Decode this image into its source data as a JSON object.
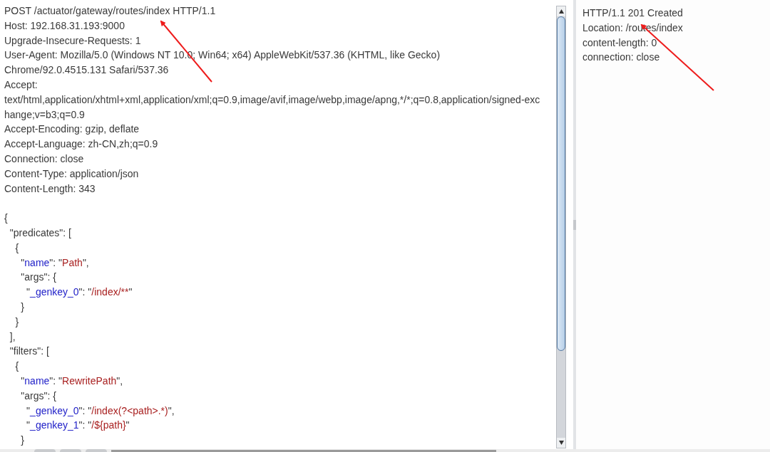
{
  "request": {
    "header_lines": [
      "POST /actuator/gateway/routes/index HTTP/1.1",
      "Host: 192.168.31.193:9000",
      "Upgrade-Insecure-Requests: 1",
      "User-Agent: Mozilla/5.0 (Windows NT 10.0; Win64; x64) AppleWebKit/537.36 (KHTML, like Gecko)",
      "Chrome/92.0.4515.131 Safari/537.36",
      "Accept:",
      "text/html,application/xhtml+xml,application/xml;q=0.9,image/avif,image/webp,image/apng,*/*;q=0.8,application/signed-exc",
      "hange;v=b3;q=0.9",
      "Accept-Encoding: gzip, deflate",
      "Accept-Language: zh-CN,zh;q=0.9",
      "Connection: close",
      "Content-Type: application/json",
      "Content-Length: 343"
    ],
    "body_lines": [
      [
        {
          "kind": "plain",
          "text": "{"
        }
      ],
      [
        {
          "kind": "plain",
          "text": "  \"predicates\": ["
        }
      ],
      [
        {
          "kind": "plain",
          "text": "    {"
        }
      ],
      [
        {
          "kind": "plain",
          "text": "      \""
        },
        {
          "kind": "key",
          "text": "name"
        },
        {
          "kind": "plain",
          "text": "\": \""
        },
        {
          "kind": "string",
          "text": "Path"
        },
        {
          "kind": "plain",
          "text": "\","
        }
      ],
      [
        {
          "kind": "plain",
          "text": "      \"args\": {"
        }
      ],
      [
        {
          "kind": "plain",
          "text": "        \""
        },
        {
          "kind": "key",
          "text": "_genkey_0"
        },
        {
          "kind": "plain",
          "text": "\": \""
        },
        {
          "kind": "string",
          "text": "/index/**"
        },
        {
          "kind": "plain",
          "text": "\""
        }
      ],
      [
        {
          "kind": "plain",
          "text": "      }"
        }
      ],
      [
        {
          "kind": "plain",
          "text": "    }"
        }
      ],
      [
        {
          "kind": "plain",
          "text": "  ],"
        }
      ],
      [
        {
          "kind": "plain",
          "text": "  \"filters\": ["
        }
      ],
      [
        {
          "kind": "plain",
          "text": "    {"
        }
      ],
      [
        {
          "kind": "plain",
          "text": "      \""
        },
        {
          "kind": "key",
          "text": "name"
        },
        {
          "kind": "plain",
          "text": "\": \""
        },
        {
          "kind": "string",
          "text": "RewritePath"
        },
        {
          "kind": "plain",
          "text": "\","
        }
      ],
      [
        {
          "kind": "plain",
          "text": "      \"args\": {"
        }
      ],
      [
        {
          "kind": "plain",
          "text": "        \""
        },
        {
          "kind": "key",
          "text": "_genkey_0"
        },
        {
          "kind": "plain",
          "text": "\": \""
        },
        {
          "kind": "string",
          "text": "/index(?<path>.*)"
        },
        {
          "kind": "plain",
          "text": "\","
        }
      ],
      [
        {
          "kind": "plain",
          "text": "        \""
        },
        {
          "kind": "key",
          "text": "_genkey_1"
        },
        {
          "kind": "plain",
          "text": "\": \""
        },
        {
          "kind": "string",
          "text": "/${path}"
        },
        {
          "kind": "plain",
          "text": "\""
        }
      ],
      [
        {
          "kind": "plain",
          "text": "      }"
        }
      ]
    ]
  },
  "response": {
    "header_lines": [
      "HTTP/1.1 201 Created",
      "Location: /routes/index",
      "content-length: 0",
      "connection: close"
    ]
  }
}
